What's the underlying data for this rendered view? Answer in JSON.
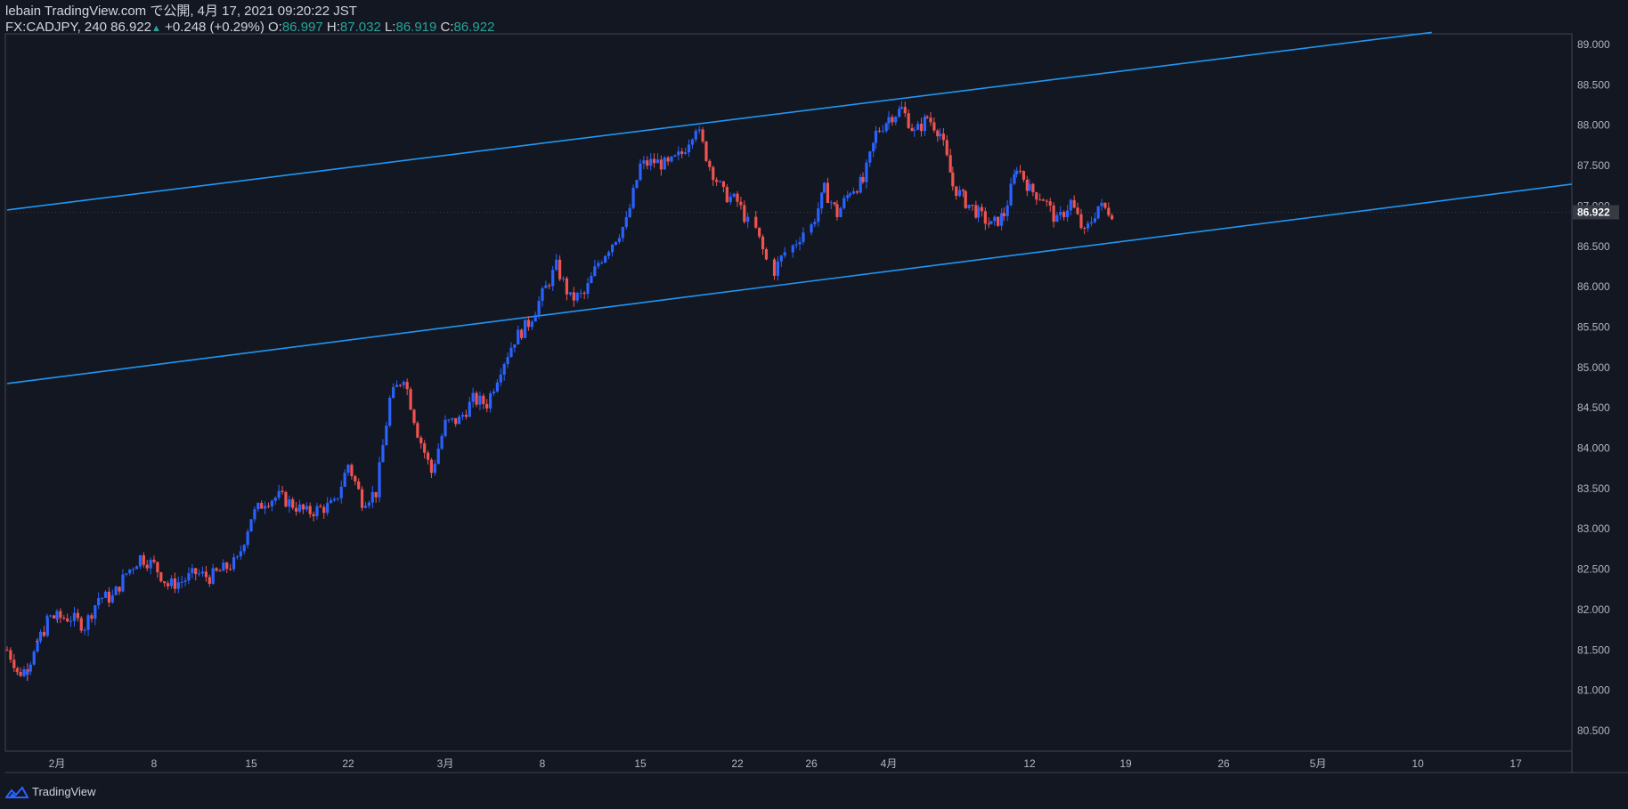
{
  "header": {
    "publish_line": "lebain TradingView.com で公開, 4月 17, 2021 09:20:22 JST",
    "symbol_interval": "FX:CADJPY, 240",
    "last": "86.922",
    "change_arrow": "▲",
    "change": "+0.248 (+0.29%)",
    "o_label": "O:",
    "o_value": "86.997",
    "h_label": "H:",
    "h_value": "87.032",
    "l_label": "L:",
    "l_value": "86.919",
    "c_label": "C:",
    "c_value": "86.922"
  },
  "footer": {
    "brand": "TradingView"
  },
  "colors": {
    "background": "#131722",
    "up": "#2962ff",
    "down": "#ef5350",
    "channel": "#2196f3",
    "axis_text": "#b2b5be",
    "price_tag_bg": "#363a45"
  },
  "chart_data": {
    "type": "candlestick",
    "symbol": "FX:CADJPY",
    "interval": "240",
    "ylim": [
      80.3,
      89.2
    ],
    "y_ticks": [
      "89.000",
      "88.500",
      "88.000",
      "87.500",
      "87.000",
      "86.500",
      "86.000",
      "85.500",
      "85.000",
      "84.500",
      "84.000",
      "83.500",
      "83.000",
      "82.500",
      "82.000",
      "81.500",
      "81.000",
      "80.500"
    ],
    "x_ticks": [
      "2月",
      "8",
      "15",
      "22",
      "3月",
      "8",
      "15",
      "22",
      "26",
      "4月",
      "12",
      "19",
      "26",
      "5月",
      "10",
      "17"
    ],
    "x_tick_dates": [
      "2021-02-01",
      "2021-02-08",
      "2021-02-15",
      "2021-02-22",
      "2021-03-01",
      "2021-03-08",
      "2021-03-15",
      "2021-03-22",
      "2021-03-26",
      "2021-04-01",
      "2021-04-12",
      "2021-04-19",
      "2021-04-26",
      "2021-05-03",
      "2021-05-10",
      "2021-05-17"
    ],
    "last_price": "86.922",
    "close_path": [
      [
        "2021-01-27",
        81.5
      ],
      [
        "2021-01-28",
        81.2
      ],
      [
        "2021-01-29",
        81.3
      ],
      [
        "2021-01-31",
        81.9
      ],
      [
        "2021-02-02",
        81.9
      ],
      [
        "2021-02-03",
        81.8
      ],
      [
        "2021-02-04",
        82.15
      ],
      [
        "2021-02-05",
        82.15
      ],
      [
        "2021-02-06",
        82.45
      ],
      [
        "2021-02-07",
        82.65
      ],
      [
        "2021-02-08",
        82.55
      ],
      [
        "2021-02-09",
        82.3
      ],
      [
        "2021-02-10",
        82.35
      ],
      [
        "2021-02-11",
        82.45
      ],
      [
        "2021-02-12",
        82.4
      ],
      [
        "2021-02-14",
        82.6
      ],
      [
        "2021-02-15",
        83.15
      ],
      [
        "2021-02-16",
        83.35
      ],
      [
        "2021-02-17",
        83.4
      ],
      [
        "2021-02-18",
        83.3
      ],
      [
        "2021-02-19",
        83.2
      ],
      [
        "2021-02-21",
        83.3
      ],
      [
        "2021-02-22",
        83.8
      ],
      [
        "2021-02-23",
        83.35
      ],
      [
        "2021-02-24",
        83.45
      ],
      [
        "2021-02-25",
        84.6
      ],
      [
        "2021-02-26",
        84.9
      ],
      [
        "2021-02-27",
        84.2
      ],
      [
        "2021-02-28",
        83.7
      ],
      [
        "2021-03-01",
        84.3
      ],
      [
        "2021-03-02",
        84.35
      ],
      [
        "2021-03-03",
        84.6
      ],
      [
        "2021-03-04",
        84.55
      ],
      [
        "2021-03-05",
        85.0
      ],
      [
        "2021-03-06",
        85.35
      ],
      [
        "2021-03-07",
        85.55
      ],
      [
        "2021-03-08",
        85.9
      ],
      [
        "2021-03-09",
        86.25
      ],
      [
        "2021-03-10",
        85.85
      ],
      [
        "2021-03-11",
        85.9
      ],
      [
        "2021-03-12",
        86.3
      ],
      [
        "2021-03-14",
        86.8
      ],
      [
        "2021-03-15",
        87.5
      ],
      [
        "2021-03-16",
        87.55
      ],
      [
        "2021-03-17",
        87.5
      ],
      [
        "2021-03-18",
        87.65
      ],
      [
        "2021-03-19",
        88.0
      ],
      [
        "2021-03-20",
        87.5
      ],
      [
        "2021-03-21",
        87.15
      ],
      [
        "2021-03-22",
        87.05
      ],
      [
        "2021-03-23",
        86.7
      ],
      [
        "2021-03-24",
        86.2
      ],
      [
        "2021-03-25",
        86.5
      ],
      [
        "2021-03-26",
        86.75
      ],
      [
        "2021-03-27",
        87.2
      ],
      [
        "2021-03-28",
        86.9
      ],
      [
        "2021-03-29",
        87.2
      ],
      [
        "2021-03-30",
        87.3
      ],
      [
        "2021-03-31",
        87.9
      ],
      [
        "2021-04-01",
        88.1
      ],
      [
        "2021-04-02",
        88.2
      ],
      [
        "2021-04-03",
        87.9
      ],
      [
        "2021-04-04",
        88.1
      ],
      [
        "2021-04-05",
        87.9
      ],
      [
        "2021-04-06",
        87.25
      ],
      [
        "2021-04-07",
        87.05
      ],
      [
        "2021-04-08",
        86.9
      ],
      [
        "2021-04-09",
        86.75
      ],
      [
        "2021-04-10",
        86.9
      ],
      [
        "2021-04-11",
        87.5
      ],
      [
        "2021-04-12",
        87.2
      ],
      [
        "2021-04-13",
        87.1
      ],
      [
        "2021-04-14",
        86.8
      ],
      [
        "2021-04-15",
        87.05
      ],
      [
        "2021-04-16",
        86.65
      ],
      [
        "2021-04-17",
        87.0
      ],
      [
        "2021-04-18",
        86.922
      ]
    ],
    "channel_lines": [
      {
        "name": "",
        "points": [
          [
            "2021-01-27",
            86.95
          ],
          [
            "2021-05-11",
            89.15
          ]
        ]
      },
      {
        "name": "",
        "points": [
          [
            "2021-01-27",
            84.8
          ],
          [
            "2021-05-27",
            87.27
          ]
        ]
      }
    ]
  }
}
